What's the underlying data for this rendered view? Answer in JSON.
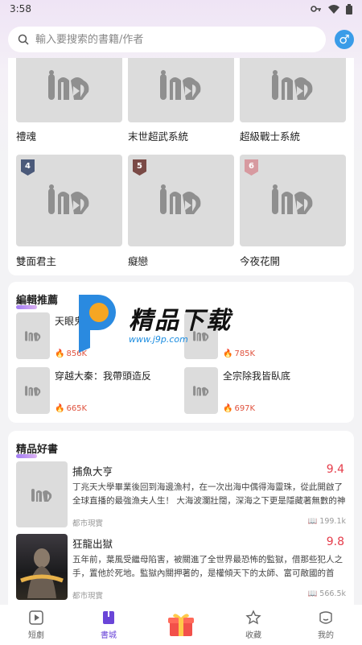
{
  "status": {
    "time": "3:58"
  },
  "search": {
    "placeholder": "輸入要搜索的書籍/作者",
    "gender_symbol": "♂"
  },
  "grid": {
    "top_row": [
      "禮魂",
      "末世超武系統",
      "超級戰士系統"
    ],
    "second_row": [
      {
        "rank": "4",
        "title": "雙面君主",
        "color": "#4b5a7a"
      },
      {
        "rank": "5",
        "title": "癡戀",
        "color": "#7a4a46"
      },
      {
        "rank": "6",
        "title": "今夜花開",
        "color": "#d79aa0"
      }
    ]
  },
  "editor_picks": {
    "heading": "編輯推薦",
    "items": [
      {
        "title": "天眼鬼神",
        "heat": "856K"
      },
      {
        "title": "",
        "heat": "785K"
      },
      {
        "title": "穿越大秦：我帶頭造反",
        "heat": "665K"
      },
      {
        "title": "全宗除我皆臥底",
        "heat": "697K"
      }
    ]
  },
  "quality": {
    "heading": "精品好書",
    "books": [
      {
        "title": "捕魚大亨",
        "score": "9.4",
        "desc": "丁兆天大學畢業後回到海邊漁村，在一次出海中偶得海靈珠，從此開啟了全球直播的最強漁夫人生！ 大海波瀾壯闊，深海之下更是隱藏著無數的神奇奧",
        "category": "都市現實",
        "reads": "199.1k"
      },
      {
        "title": "狂龍出獄",
        "score": "9.8",
        "desc": "五年前，葉風受繼母陷害，被關進了全世界最恐怖的監獄，借那些犯人之手，置他於死地。監獄內關押著的，是權傾天下的太師、富可敵國的首富、...",
        "category": "都市現實",
        "reads": "566.5k"
      }
    ]
  },
  "watermark": {
    "brand": "精品下载",
    "url": "www.j9p.com"
  },
  "nav": [
    {
      "label": "短劇",
      "icon": "video-icon"
    },
    {
      "label": "書城",
      "icon": "book-icon",
      "active": true
    },
    {
      "label": "",
      "icon": "gift-icon"
    },
    {
      "label": "收藏",
      "icon": "star-icon"
    },
    {
      "label": "我的",
      "icon": "profile-icon"
    }
  ],
  "colors": {
    "accent": "#6a45d8",
    "score": "#e53c4a",
    "heat": "#e0533f"
  }
}
